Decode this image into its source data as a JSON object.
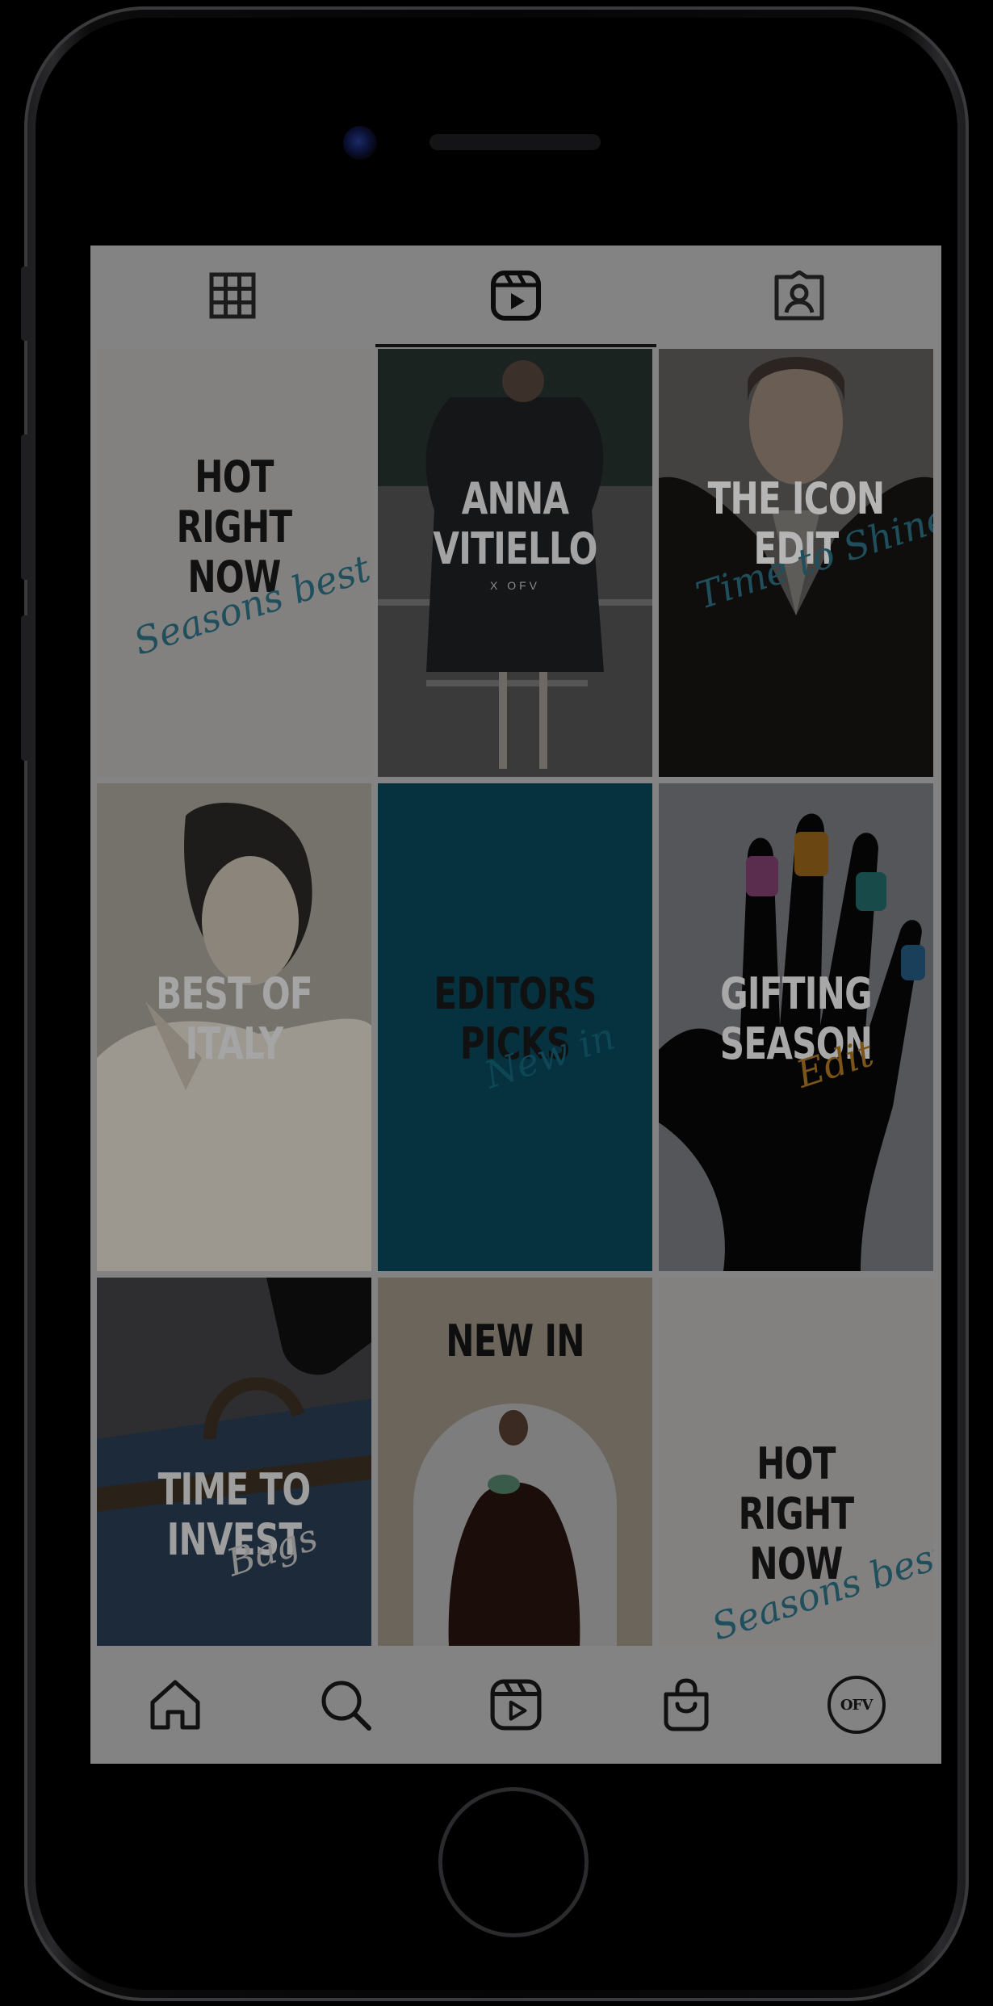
{
  "profile_tabs": [
    {
      "icon": "grid-icon",
      "active": false
    },
    {
      "icon": "reels-icon",
      "active": true
    },
    {
      "icon": "tagged-icon",
      "active": false
    }
  ],
  "tiles": [
    {
      "headline": [
        "HOT",
        "RIGHT",
        "NOW"
      ],
      "script": "Seasons best",
      "bg": "#838180",
      "headline_color": "#111111",
      "script_color": "#1f4f5c"
    },
    {
      "headline": [
        "ANNA",
        "VITIELLO"
      ],
      "sub": "X OFV",
      "bg": "#2e2f30",
      "headline_color": "#a3a3a3"
    },
    {
      "headline": [
        "THE ICON",
        "EDIT"
      ],
      "script": "Time to Shine",
      "bg": "#3a3936",
      "headline_color": "#b5b5b5",
      "script_color": "#1f4f5c"
    },
    {
      "headline": [
        "BEST OF",
        "ITALY"
      ],
      "bg": "#6f6c66",
      "headline_color": "#a5a5a5"
    },
    {
      "headline": [
        "EDITORS",
        "PICKS"
      ],
      "script": "New in",
      "bg": "#06313f",
      "headline_color": "#111111",
      "script_color": "#0e4656"
    },
    {
      "headline": [
        "GIFTING",
        "SEASON"
      ],
      "script": "Edit",
      "bg": "#55575b",
      "headline_color": "#a8a8a8",
      "script_color": "#7a5418"
    },
    {
      "headline": [
        "TIME TO",
        "INVEST"
      ],
      "script": "Bags",
      "bg": "#2c2c2e",
      "headline_color": "#9e9e9e",
      "script_color": "#8a8a8a"
    },
    {
      "headline": [
        "NEW IN"
      ],
      "bg": "#6b655c",
      "headline_color": "#0e0e0e"
    },
    {
      "headline": [
        "HOT",
        "RIGHT",
        "NOW"
      ],
      "script": "Seasons best",
      "bg": "#838180",
      "headline_color": "#111111",
      "script_color": "#1f4f5c"
    }
  ],
  "bottom_nav": [
    {
      "icon": "home-icon"
    },
    {
      "icon": "search-icon"
    },
    {
      "icon": "reels-icon"
    },
    {
      "icon": "shop-bag-icon"
    },
    {
      "icon": "profile-avatar-icon",
      "avatar_text": "OFV"
    }
  ]
}
